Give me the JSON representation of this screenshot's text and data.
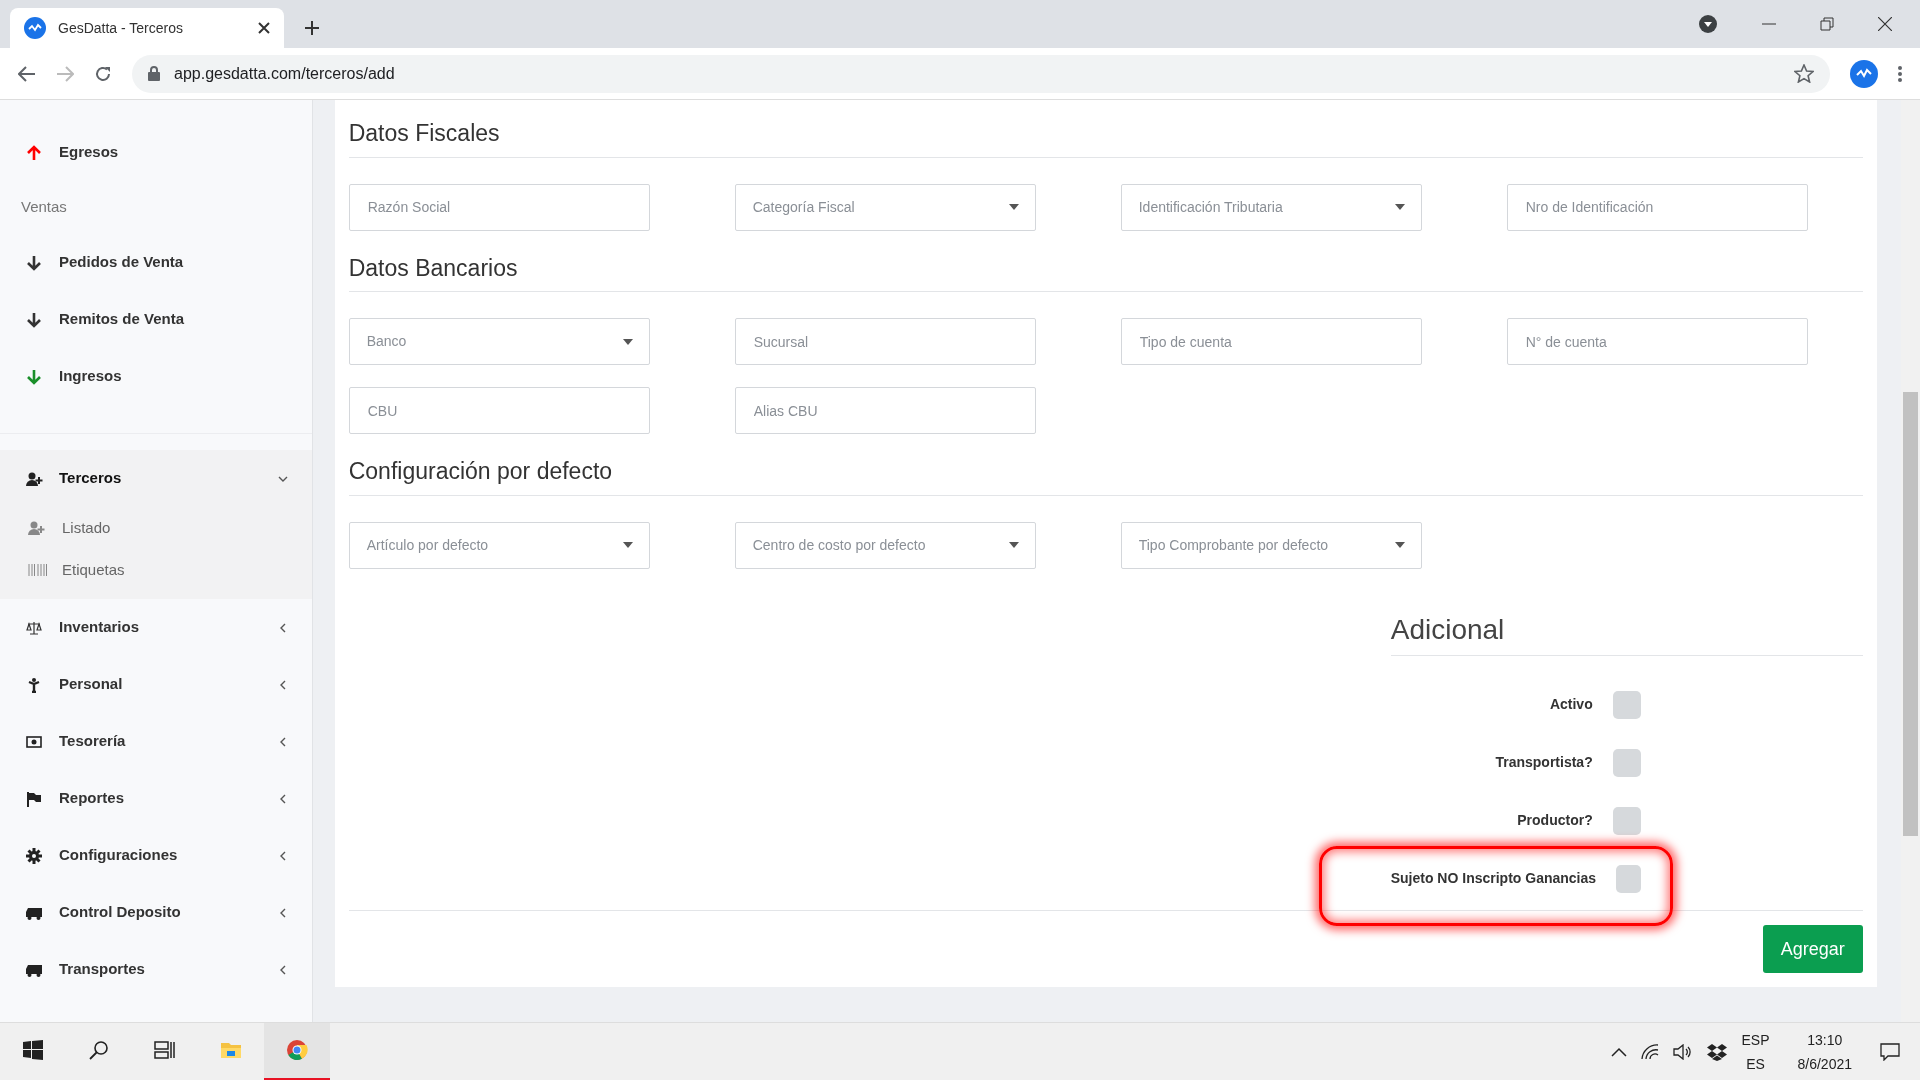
{
  "browser": {
    "tab_title": "GesDatta - Terceros",
    "url": "app.gesdatta.com/terceros/add"
  },
  "sidebar": {
    "items": [
      {
        "kind": "link",
        "label": "Egresos"
      },
      {
        "kind": "header",
        "label": "Ventas"
      },
      {
        "kind": "link",
        "label": "Pedidos de Venta"
      },
      {
        "kind": "link",
        "label": "Remitos de Venta"
      },
      {
        "kind": "link",
        "label": "Ingresos"
      },
      {
        "kind": "divider"
      },
      {
        "kind": "group",
        "label": "Terceros",
        "expanded": true,
        "children": [
          {
            "label": "Listado"
          },
          {
            "label": "Etiquetas"
          }
        ]
      },
      {
        "kind": "group",
        "label": "Inventarios",
        "expanded": false
      },
      {
        "kind": "group",
        "label": "Personal",
        "expanded": false
      },
      {
        "kind": "group",
        "label": "Tesorería",
        "expanded": false
      },
      {
        "kind": "group",
        "label": "Reportes",
        "expanded": false
      },
      {
        "kind": "group",
        "label": "Configuraciones",
        "expanded": false
      },
      {
        "kind": "group",
        "label": "Control Deposito",
        "expanded": false
      },
      {
        "kind": "group",
        "label": "Transportes",
        "expanded": false
      }
    ]
  },
  "sections": [
    {
      "title": "Datos Fiscales",
      "fields": [
        {
          "kind": "text",
          "placeholder": "Razón Social"
        },
        {
          "kind": "select",
          "value": "Categoría Fiscal"
        },
        {
          "kind": "select",
          "value": "Identificación Tributaria"
        },
        {
          "kind": "text",
          "placeholder": "Nro de Identificación"
        }
      ]
    },
    {
      "title": "Datos Bancarios",
      "fields": [
        {
          "kind": "select",
          "value": "Banco"
        },
        {
          "kind": "text",
          "placeholder": "Sucursal"
        },
        {
          "kind": "text",
          "placeholder": "Tipo de cuenta"
        },
        {
          "kind": "text",
          "placeholder": "N° de cuenta"
        },
        {
          "kind": "text",
          "placeholder": "CBU"
        },
        {
          "kind": "text",
          "placeholder": "Alias CBU"
        }
      ]
    },
    {
      "title": "Configuración por defecto",
      "fields": [
        {
          "kind": "select",
          "value": "Artículo por defecto"
        },
        {
          "kind": "select",
          "value": "Centro de costo por defecto"
        },
        {
          "kind": "select",
          "value": "Tipo Comprobante por defecto"
        }
      ]
    }
  ],
  "additional": {
    "title": "Adicional",
    "checkboxes": [
      {
        "label": "Activo",
        "checked": false,
        "highlighted": false
      },
      {
        "label": "Transportista?",
        "checked": false,
        "highlighted": false
      },
      {
        "label": "Productor?",
        "checked": false,
        "highlighted": false
      },
      {
        "label": "Sujeto NO Inscripto Ganancias",
        "checked": false,
        "highlighted": true
      }
    ]
  },
  "submit_button": "Agregar",
  "taskbar": {
    "apps": [
      {
        "selected": false
      },
      {
        "selected": true
      }
    ],
    "language": "ESP",
    "layout": "ES",
    "time": "13:10",
    "date": "8/6/2021"
  }
}
